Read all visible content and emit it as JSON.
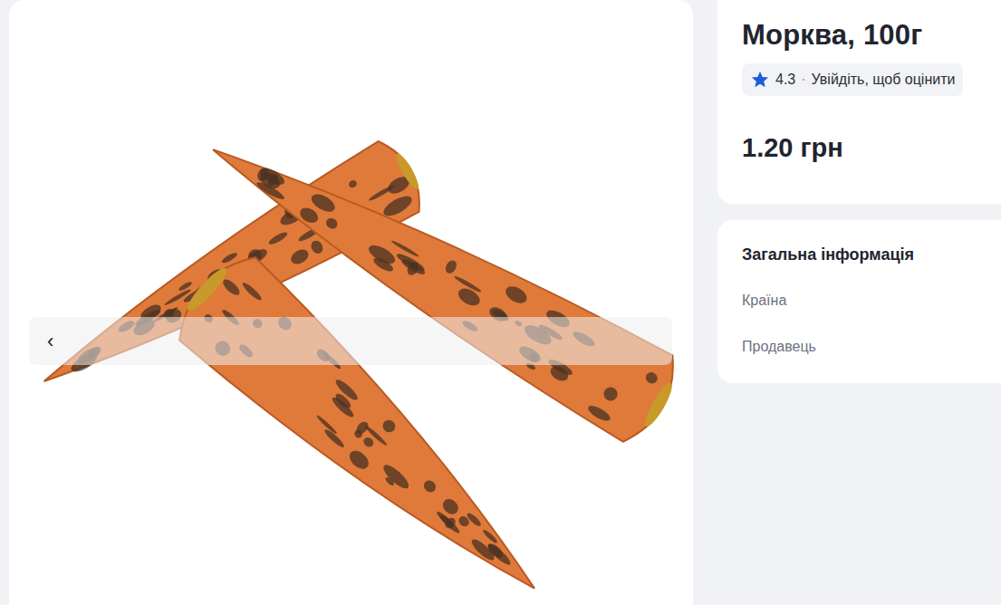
{
  "gallery": {
    "prev": "‹"
  },
  "product": {
    "title": "Морква, 100г",
    "rating": {
      "value": "4.3",
      "separator": "·",
      "login_prompt": "Увійдіть, щоб оцінити"
    },
    "price": "1.20 грн"
  },
  "info": {
    "title": "Загальна інформація",
    "rows": [
      "Країна",
      "Продавець"
    ]
  }
}
